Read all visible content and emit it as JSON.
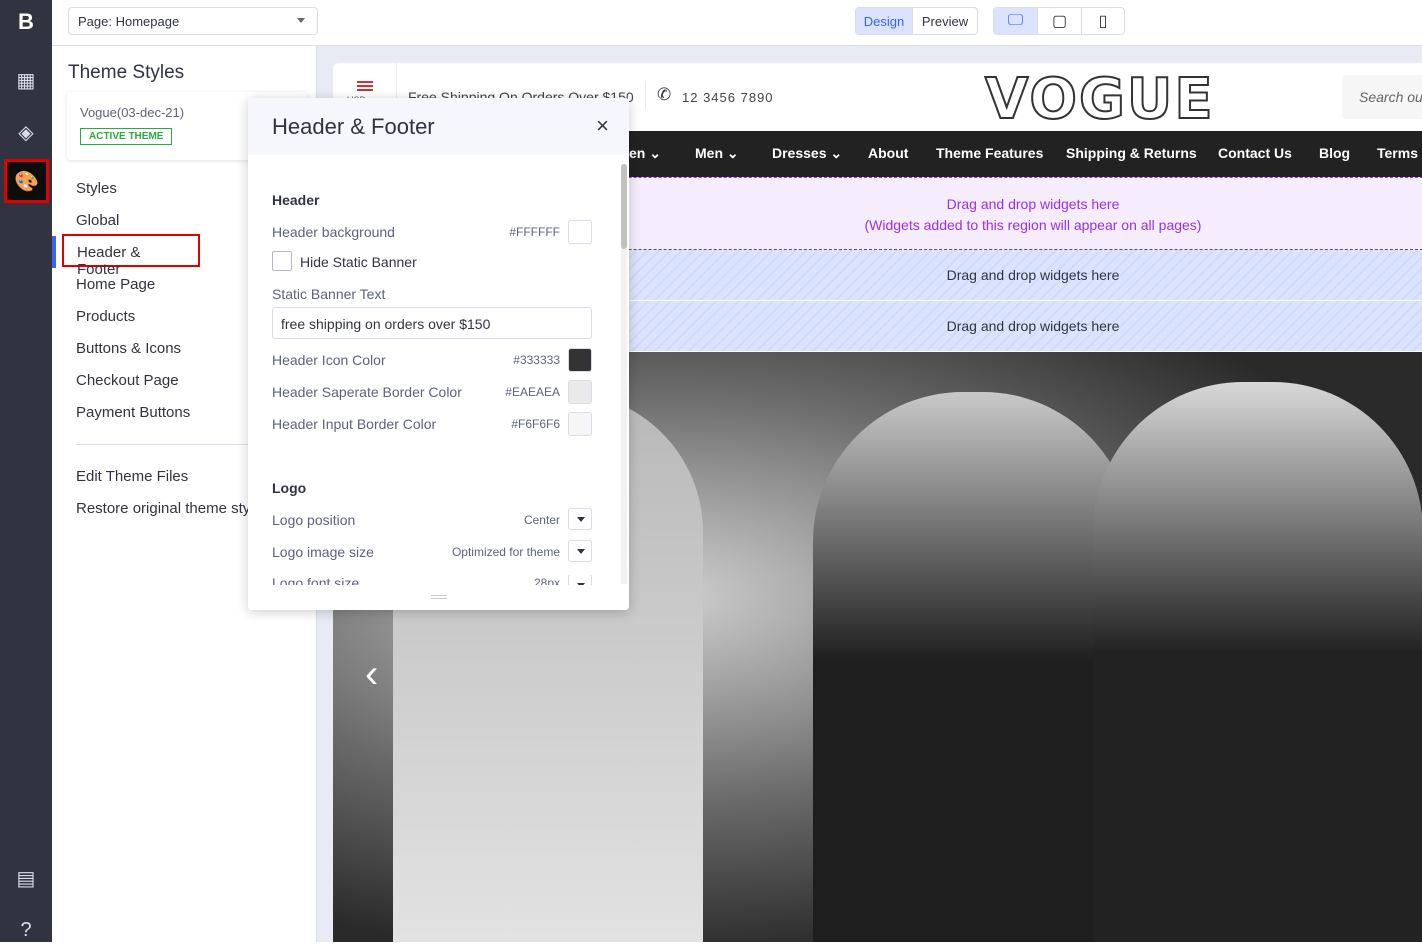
{
  "rail": {
    "icons": [
      "bigcommerce-logo-icon",
      "widgets-icon",
      "layers-icon",
      "palette-icon",
      "storefront-icon",
      "help-icon"
    ]
  },
  "topbar": {
    "page_select": "Page: Homepage",
    "mode": {
      "design": "Design",
      "preview": "Preview",
      "active": "Design"
    },
    "devices": [
      "desktop-icon",
      "tablet-icon",
      "mobile-icon"
    ],
    "active_device": "desktop"
  },
  "sidebar": {
    "title": "Theme Styles",
    "theme_name": "Vogue(03-dec-21)",
    "badge": "ACTIVE THEME",
    "items": [
      "Styles",
      "Global",
      "Header & Footer",
      "Home Page",
      "Products",
      "Buttons & Icons",
      "Checkout Page",
      "Payment Buttons"
    ],
    "active": "Header & Footer",
    "footer_items": [
      "Edit Theme Files",
      "Restore original theme sty"
    ]
  },
  "modal": {
    "title": "Header & Footer",
    "header_section": "Header",
    "header_background": {
      "label": "Header background",
      "value": "#FFFFFF"
    },
    "hide_banner": {
      "label": "Hide Static Banner",
      "checked": false
    },
    "banner_text": {
      "label": "Static Banner Text",
      "value": "free shipping on orders over $150"
    },
    "icon_color": {
      "label": "Header Icon Color",
      "value": "#333333"
    },
    "border_color": {
      "label": "Header Saperate Border Color",
      "value": "#EAEAEA"
    },
    "input_border": {
      "label": "Header Input Border Color",
      "value": "#F6F6F6"
    },
    "logo_section": "Logo",
    "logo_position": {
      "label": "Logo position",
      "value": "Center"
    },
    "logo_size": {
      "label": "Logo image size",
      "value": "Optimized for theme"
    },
    "logo_font": {
      "label": "Logo font size",
      "value": "28px"
    }
  },
  "store": {
    "currency": "USD",
    "banner": "Free Shipping On Orders Over $150",
    "phone": "12 3456 7890",
    "logo": "VOGUE",
    "search_placeholder": "Search ou",
    "nav": [
      "en",
      "Men",
      "Dresses",
      "About",
      "Theme Features",
      "Shipping & Returns",
      "Contact Us",
      "Blog",
      "Terms &"
    ],
    "dropzone_global": "Drag and drop widgets here",
    "dropzone_global_note": "(Widgets added to this region will appear on all pages)",
    "dropzone": "Drag and drop widgets here"
  },
  "colors": {
    "accent": "#3c64f4",
    "highlight": "#e00000",
    "rail": "#313440",
    "dropzone_purple": "#9b30e6"
  }
}
